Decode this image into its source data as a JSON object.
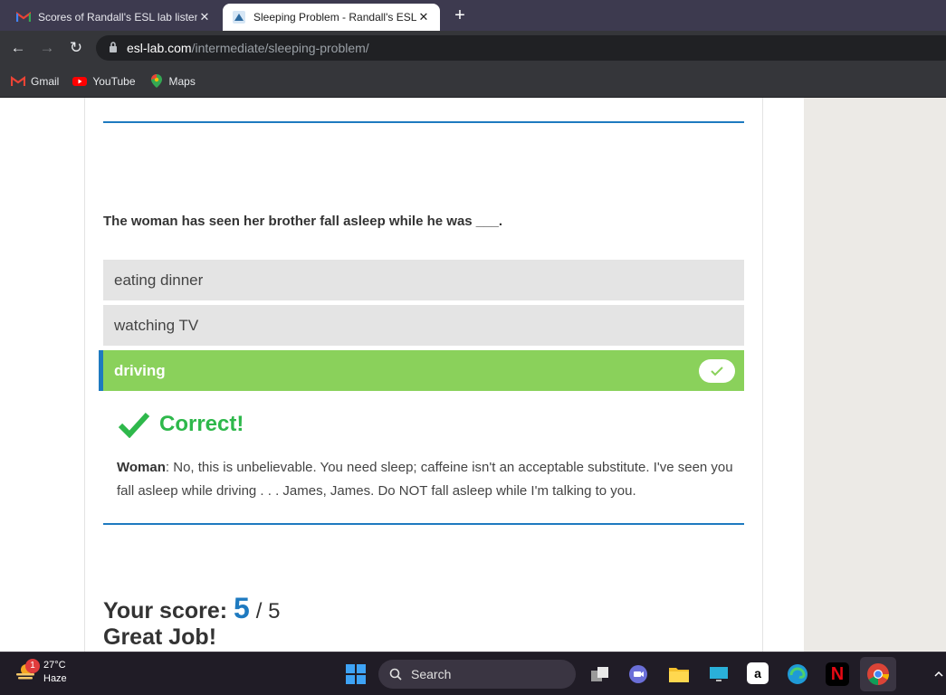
{
  "browser": {
    "tabs": [
      {
        "title": "Scores of Randall's ESL lab listen",
        "favicon": "gmail-icon",
        "active": false
      },
      {
        "title": "Sleeping Problem - Randall's ESL",
        "favicon": "esl-lab-icon",
        "active": true
      }
    ],
    "close_glyph": "✕",
    "new_tab_glyph": "+",
    "url_host": "esl-lab.com",
    "url_path": "/intermediate/sleeping-problem/",
    "bookmarks": [
      {
        "label": "Gmail",
        "icon": "gmail-icon"
      },
      {
        "label": "YouTube",
        "icon": "youtube-icon"
      },
      {
        "label": "Maps",
        "icon": "maps-icon"
      }
    ]
  },
  "quiz": {
    "question": "The woman has seen her brother fall asleep while he was ___.",
    "answers": [
      {
        "label": "eating dinner",
        "state": "default"
      },
      {
        "label": "watching TV",
        "state": "default"
      },
      {
        "label": "driving",
        "state": "selected-correct"
      }
    ],
    "feedback": {
      "label": "Correct!",
      "speaker": "Woman",
      "text": ": No, this is unbelievable. You need sleep; caffeine isn't an acceptable substitute. I've seen you fall asleep while driving . . . James, James. Do NOT fall asleep while I'm talking to you."
    },
    "score": {
      "label": "Your score:",
      "value": "5",
      "separator": "/ 5",
      "message": "Great Job!"
    }
  },
  "taskbar": {
    "weather_temp": "27°C",
    "weather_desc": "Haze",
    "notification_count": "1",
    "search_placeholder": "Search"
  },
  "colors": {
    "accent_blue": "#1e7ac0",
    "correct_green": "#8ad15b",
    "feedback_green": "#2eb84b"
  }
}
